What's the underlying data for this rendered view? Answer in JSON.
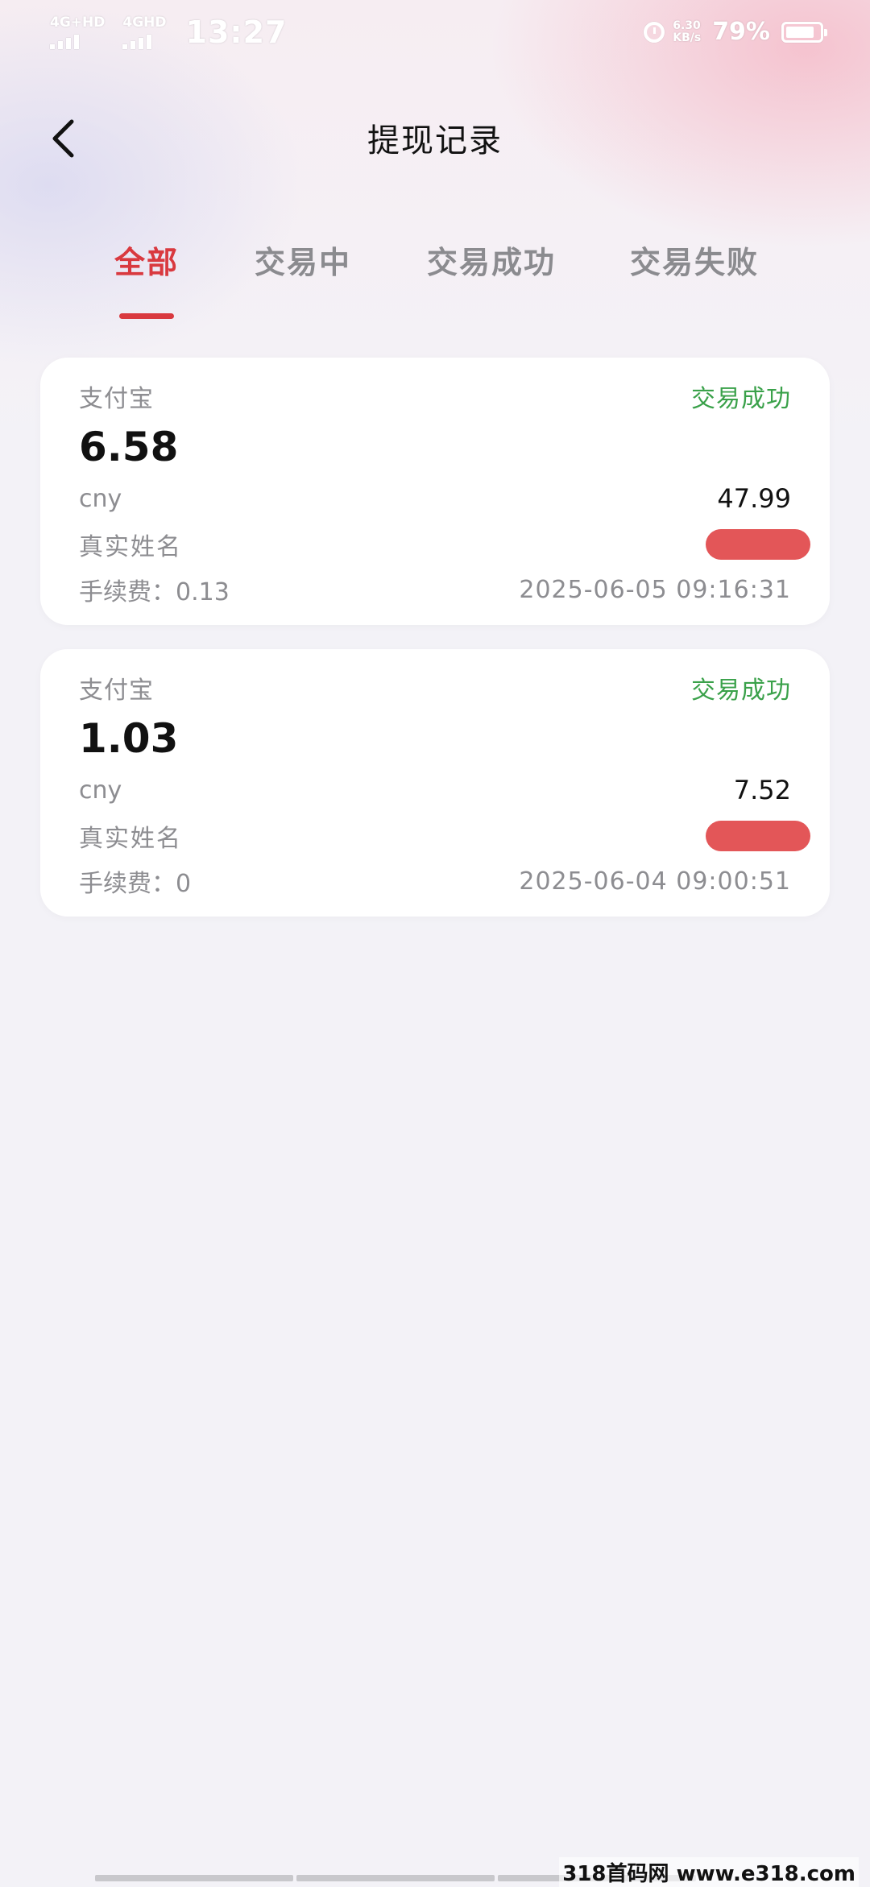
{
  "status_bar": {
    "network_1": "4G+HD",
    "network_2": "4GHD",
    "time": "13:27",
    "speed_value": "6.30",
    "speed_unit": "KB/s",
    "battery": "79%"
  },
  "header": {
    "title": "提现记录",
    "back_icon": "chevron-left-icon"
  },
  "tabs": [
    {
      "label": "全部",
      "active": true
    },
    {
      "label": "交易中",
      "active": false
    },
    {
      "label": "交易成功",
      "active": false
    },
    {
      "label": "交易失败",
      "active": false
    }
  ],
  "records": [
    {
      "channel": "支付宝",
      "status": "交易成功",
      "amount": "6.58",
      "currency": "cny",
      "converted": "47.99",
      "name_label": "真实姓名",
      "fee": "手续费：0.13",
      "time": "2025-06-05 09:16:31"
    },
    {
      "channel": "支付宝",
      "status": "交易成功",
      "amount": "1.03",
      "currency": "cny",
      "converted": "7.52",
      "name_label": "真实姓名",
      "fee": "手续费：0",
      "time": "2025-06-04 09:00:51"
    }
  ],
  "watermark": "318首码网 www.e318.com",
  "colors": {
    "accent": "#d9393f",
    "success": "#3aa14a",
    "muted_text": "#8d8d91",
    "background": "#f3f2f7",
    "redaction": "#e35658"
  }
}
